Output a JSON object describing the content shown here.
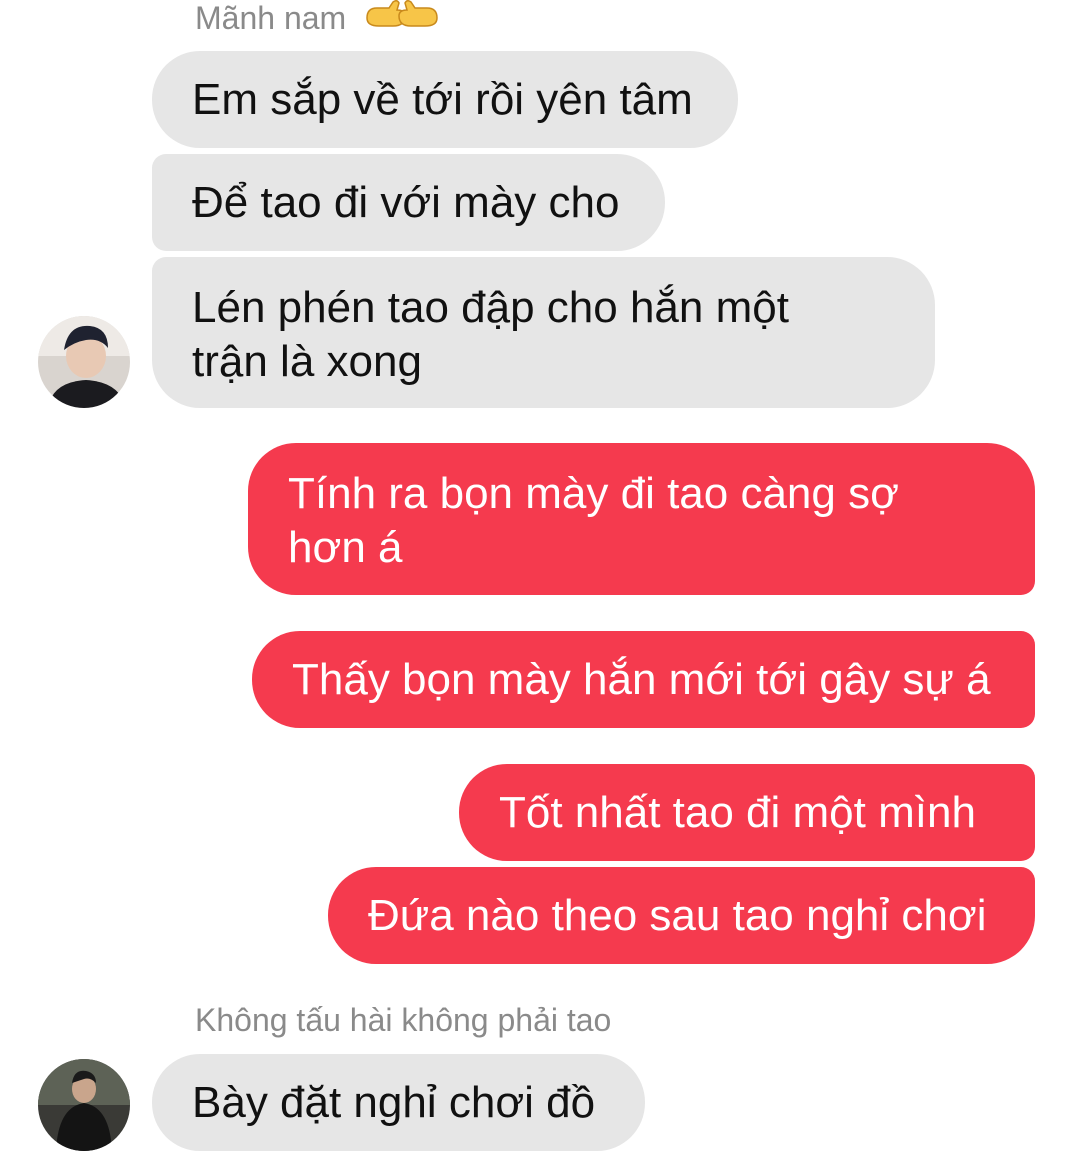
{
  "group1": {
    "sender": "Mãnh nam",
    "sender_emoji": "pointing-hands-emoji",
    "messages": [
      "Em sắp về tới rồi yên tâm",
      "Để tao đi với mày cho",
      "Lén phén tao đập cho hắn một trận là xong"
    ],
    "avatar": "user-avatar-photo"
  },
  "outgoing": {
    "color": "#f53a4e",
    "messages": [
      "Tính ra bọn mày đi tao càng sợ hơn á",
      "Thấy bọn mày hắn mới tới gây sự á",
      "Tốt nhất tao đi một mình",
      "Đứa nào theo sau tao nghỉ chơi"
    ]
  },
  "group2": {
    "sender": "Không tấu hài không phải tao",
    "messages": [
      "Bày đặt nghỉ chơi đồ"
    ],
    "avatar": "user-avatar-photo"
  },
  "colors": {
    "incoming_bubble": "#e6e6e6",
    "outgoing_bubble": "#f53a4e",
    "sender_name": "#8a8a8a"
  }
}
